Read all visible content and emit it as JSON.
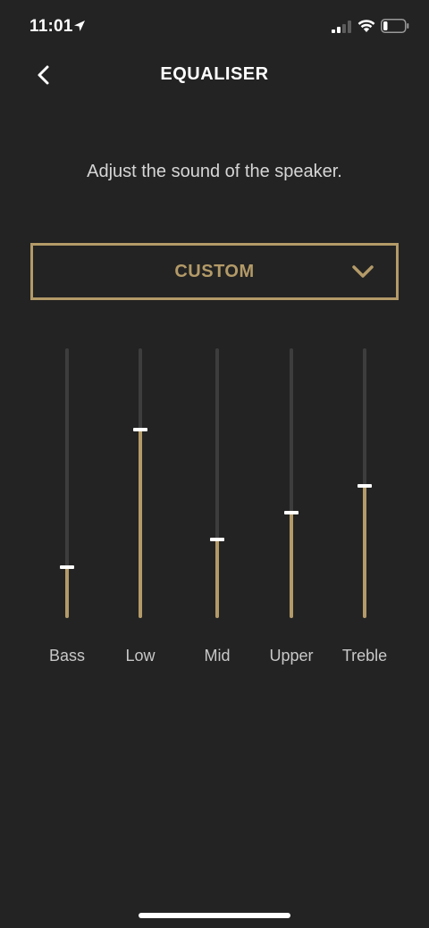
{
  "status_bar": {
    "time": "11:01",
    "battery_level": 0.2
  },
  "header": {
    "title": "EQUALISER",
    "back_icon": "chevron-left-icon"
  },
  "subtitle": "Adjust the sound of the speaker.",
  "preset": {
    "selected": "CUSTOM",
    "icon": "chevron-down-icon"
  },
  "bands": [
    {
      "label": "Bass",
      "level": 0.19
    },
    {
      "label": "Low",
      "level": 0.7
    },
    {
      "label": "Mid",
      "level": 0.29
    },
    {
      "label": "Upper",
      "level": 0.39
    },
    {
      "label": "Treble",
      "level": 0.49
    }
  ],
  "colors": {
    "accent": "#b39a68",
    "background": "#232323",
    "track": "#3d3d3d"
  }
}
